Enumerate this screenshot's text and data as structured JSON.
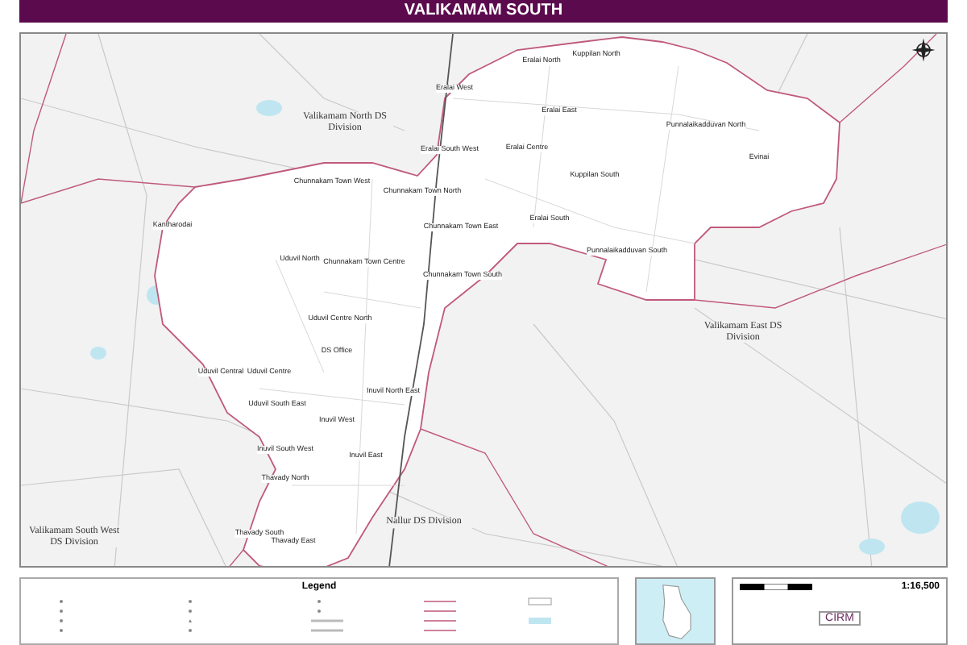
{
  "title": "VALIKAMAM SOUTH",
  "map": {
    "divisions": [
      "Valikamam North DS Division",
      "Valikamam East DS Division",
      "Valikamam South West DS Division",
      "Nallur DS Division"
    ],
    "areas": [
      "Eralai North",
      "Kuppilan North",
      "Eralai West",
      "Eralai East",
      "Eralai South West",
      "Eralai Centre",
      "Kuppilan South",
      "Punnalaikadduvan North",
      "Evinai",
      "Chunnakam Town North",
      "Chunnakam Town East",
      "Eralai South",
      "Punnalaikadduvan South",
      "Chunnakam Town South",
      "Chunnakam Town West",
      "Kantharodai",
      "Uduvil North",
      "Chunnakam Town Centre",
      "Uduvil Centre North",
      "DS Office",
      "Uduvil Central",
      "Uduvil Centre",
      "Inuvil North East",
      "Uduvil South East",
      "Inuvil West",
      "Inuvil South West",
      "Inuvil East",
      "Thavady North",
      "Thavady South",
      "Thavady East"
    ]
  },
  "legend": {
    "title": "Legend"
  },
  "scale_box": {
    "scale": "1:16,500",
    "logo": "CIRM"
  }
}
